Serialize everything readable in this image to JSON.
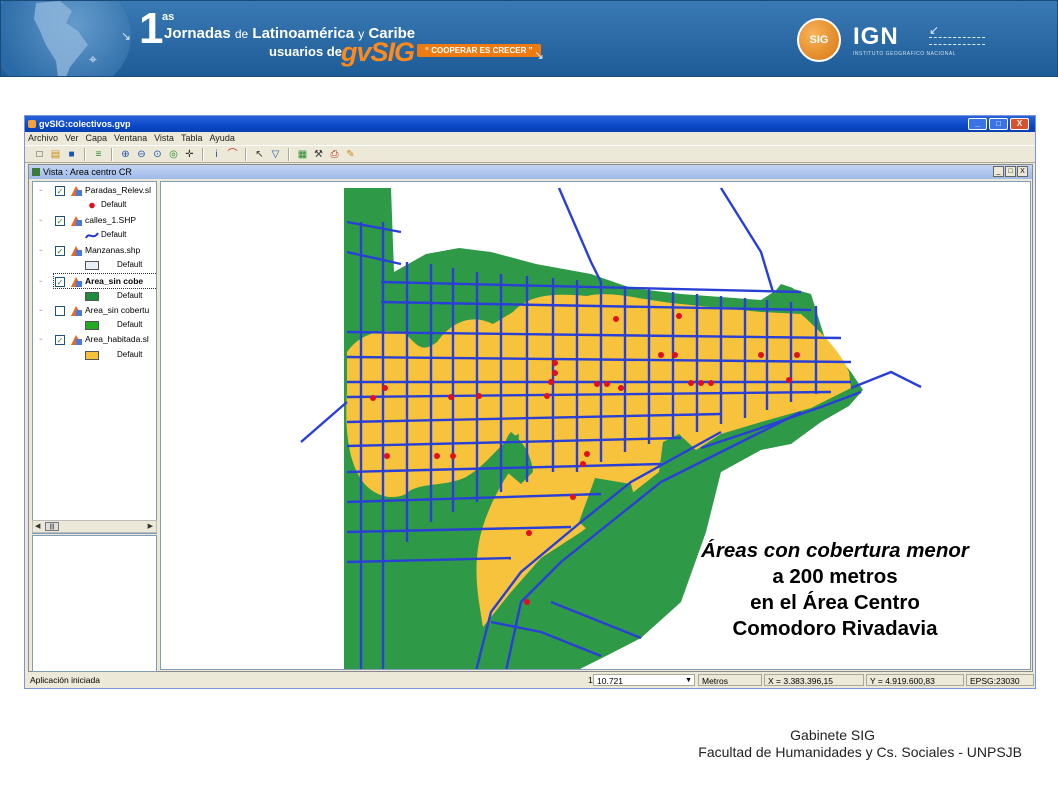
{
  "banner": {
    "edition_number": "1",
    "edition_suffix": "as",
    "line1_a": "Jornadas",
    "line1_b": "de",
    "line1_c": "Latinoamérica",
    "line1_d": "y",
    "line1_e": "Caribe",
    "line2": "usuarios de",
    "brand": "gvSIG",
    "slogan": "“ COOPERAR ES CRECER ”",
    "sig_logo_text": "SIG",
    "ign_logo_text": "IGN",
    "ign_subtext": "INSTITUTO GEOGRAFICO NACIONAL",
    "colors": {
      "banner_bg": "#2a6aa6",
      "brand_orange": "#ff8a1c"
    }
  },
  "window": {
    "title": "gvSIG:colectivos.gvp",
    "controls": [
      "_",
      "□",
      "X"
    ]
  },
  "menu": [
    "Archivo",
    "Ver",
    "Capa",
    "Ventana",
    "Vista",
    "Tabla",
    "Ayuda"
  ],
  "toolbar_icons": [
    {
      "name": "new-icon",
      "glyph": "□"
    },
    {
      "name": "open-icon",
      "glyph": "▤"
    },
    {
      "name": "save-icon",
      "glyph": "■"
    },
    {
      "name": "layers-icon",
      "glyph": "≡"
    },
    {
      "name": "zoom-in-icon",
      "glyph": "⊕"
    },
    {
      "name": "zoom-out-icon",
      "glyph": "⊖"
    },
    {
      "name": "zoom-full-icon",
      "glyph": "⊙"
    },
    {
      "name": "zoom-layer-icon",
      "glyph": "◎"
    },
    {
      "name": "pan-icon",
      "glyph": "✛"
    },
    {
      "name": "info-icon",
      "glyph": "i"
    },
    {
      "name": "measure-icon",
      "glyph": "⌒"
    },
    {
      "name": "select-icon",
      "glyph": "↖"
    },
    {
      "name": "filter-icon",
      "glyph": "▽"
    },
    {
      "name": "table-icon",
      "glyph": "▦"
    },
    {
      "name": "tools-icon",
      "glyph": "⚒"
    },
    {
      "name": "print-icon",
      "glyph": "⎙"
    },
    {
      "name": "edit-icon",
      "glyph": "✎"
    }
  ],
  "view": {
    "title": "Vista : Area centro CR",
    "controls": [
      "_",
      "□",
      "X"
    ]
  },
  "toc": {
    "layers": [
      {
        "label": "Paradas_Relev.sl",
        "checked": true,
        "bold": false,
        "legend": "Default",
        "symbol": "point",
        "color": "#e01020"
      },
      {
        "label": "calles_1.SHP",
        "checked": true,
        "bold": false,
        "legend": "Default",
        "symbol": "line",
        "color": "#2233cc"
      },
      {
        "label": "Manzanas.shp",
        "checked": true,
        "bold": false,
        "legend": "Default",
        "symbol": "fill",
        "color": "#e8eef8"
      },
      {
        "label": "Area_sin cobe",
        "checked": true,
        "bold": true,
        "legend": "Default",
        "symbol": "fill",
        "color": "#1f8a3a"
      },
      {
        "label": "Area_sin cobertu",
        "checked": false,
        "bold": false,
        "legend": "Default",
        "symbol": "fill",
        "color": "#22aa22"
      },
      {
        "label": "Area_habitada.sl",
        "checked": true,
        "bold": false,
        "legend": "Default",
        "symbol": "fill",
        "color": "#f6c23b"
      }
    ]
  },
  "map": {
    "colors": {
      "uncovered": "#2e9a48",
      "covered": "#f7c33c",
      "streets": "#2a3fd6",
      "stops": "#e0101e"
    }
  },
  "status": {
    "message": "Aplicación iniciada",
    "scale_prefix": "1:",
    "scale_value": "10.721",
    "units": "Metros",
    "x": "X = 3.383.396,15",
    "y": "Y = 4.919.600,83",
    "epsg": "EPSG:23030"
  },
  "caption": {
    "line1": "Áreas con cobertura menor",
    "line2": "a 200 metros",
    "line3": "en el Área Centro",
    "line4": "Comodoro Rivadavia"
  },
  "footer": {
    "line1": "Gabinete SIG",
    "line2": "Facultad de Humanidades y Cs. Sociales - UNPSJB"
  }
}
